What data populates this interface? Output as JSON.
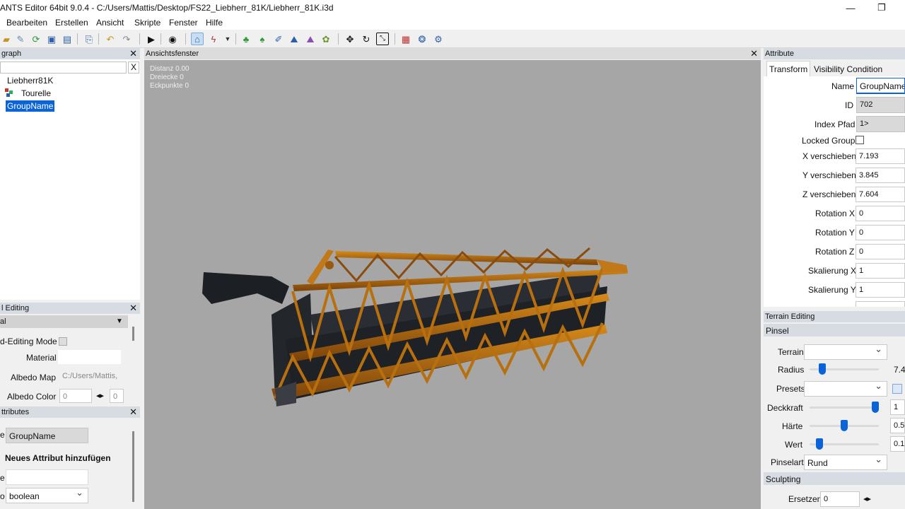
{
  "window": {
    "title": "ANTS Editor 64bit 9.0.4 - C:/Users/Mattis/Desktop/FS22_Liebherr_81K/Liebherr_81K.i3d",
    "minimize": "—",
    "maximize": "❐"
  },
  "menu": [
    "Bearbeiten",
    "Erstellen",
    "Ansicht",
    "Skripte",
    "Fenster",
    "Hilfe"
  ],
  "scenegraph": {
    "title": "graph",
    "filter_clear": "X",
    "nodes": [
      "Liebherr81K",
      "Tourelle",
      "GroupName"
    ]
  },
  "viewport": {
    "title": "Ansichtsfenster",
    "stats": [
      "Distanz 0.00",
      "Dreiecke 0",
      "Eckpunkte 0"
    ]
  },
  "material_panel": {
    "title": "l Editing",
    "mode_value": "al",
    "editing_mode_label": "d-Editing Mode",
    "material_label": "Material",
    "albedo_map_label": "Albedo Map",
    "albedo_map_value": "C:/Users/Mattis,",
    "albedo_color_label": "Albedo Color",
    "albedo_color_r": "0",
    "albedo_color_g": "0"
  },
  "user_attributes": {
    "title": "ttributes",
    "name_label_fragment": "e",
    "name_value": "GroupName",
    "add_title": "Neues Attribut hinzufügen",
    "attr_name_label_fragment": "e",
    "type_label_fragment": "o",
    "type_value": "boolean"
  },
  "attributes": {
    "title": "Attribute",
    "tabs": [
      "Transform",
      "Visibility Condition"
    ],
    "name_label": "Name",
    "name_value": "GroupName",
    "id_label": "ID",
    "id_value": "702",
    "index_label": "Index Pfad",
    "index_value": "1>",
    "locked_label": "Locked Group",
    "rows": [
      {
        "label": "X verschieben",
        "value": "7.193"
      },
      {
        "label": "Y verschieben",
        "value": "3.845"
      },
      {
        "label": "Z verschieben",
        "value": "7.604"
      },
      {
        "label": "Rotation X",
        "value": "0"
      },
      {
        "label": "Rotation Y",
        "value": "0"
      },
      {
        "label": "Rotation Z",
        "value": "0"
      },
      {
        "label": "Skalierung X",
        "value": "1"
      },
      {
        "label": "Skalierung Y",
        "value": "1"
      }
    ]
  },
  "terrain": {
    "title": "Terrain Editing",
    "brush_section": "Pinsel",
    "terrain_label": "Terrain",
    "radius_label": "Radius",
    "radius_value": "7.4",
    "radius_level": 0.18,
    "presets_label": "Presets",
    "opacity_label": "Deckkraft",
    "opacity_value": "1",
    "opacity_level": 0.95,
    "hardness_label": "Härte",
    "hardness_value": "0.5",
    "hardness_level": 0.5,
    "value_label": "Wert",
    "value_value": "0.1",
    "value_level": 0.14,
    "brushtype_label": "Pinselart",
    "brushtype_value": "Rund",
    "sculpt_section": "Sculpting",
    "replace_label": "Ersetzen",
    "replace_value": "0"
  },
  "colors": {
    "selection": "#0a64d8",
    "viewport_bg": "#a6a6a6",
    "panel_header": "#d7dce3",
    "crane_orange": "#b86a10",
    "crane_dark": "#1c1f24"
  }
}
